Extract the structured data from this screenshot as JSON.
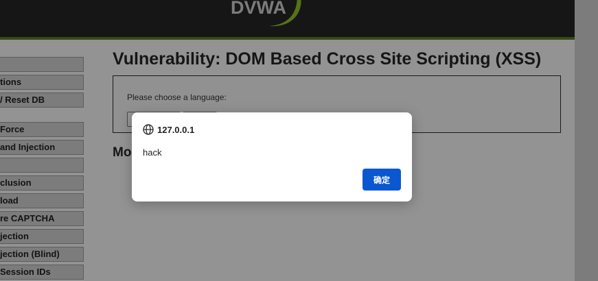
{
  "header": {
    "logo_text": "DVWA"
  },
  "menu": {
    "items": [
      {
        "label": ""
      },
      {
        "label": "tions"
      },
      {
        "label": "/ Reset DB"
      },
      {
        "label": ""
      },
      {
        "label": "Force"
      },
      {
        "label": "and Injection"
      },
      {
        "label": ""
      },
      {
        "label": "clusion"
      },
      {
        "label": "load"
      },
      {
        "label": "re CAPTCHA"
      },
      {
        "label": "jection"
      },
      {
        "label": "jection (Blind)"
      },
      {
        "label": "Session IDs"
      }
    ]
  },
  "main": {
    "title": "Vulnerability: DOM Based Cross Site Scripting (XSS)",
    "choose_label": "Please choose a language:",
    "more_info_heading": "Mo"
  },
  "dialog": {
    "origin": "127.0.0.1",
    "message": "hack",
    "ok_label": "确定",
    "icon": "globe-icon"
  },
  "colors": {
    "header_bg": "#262626",
    "header_accent": "#5e7d1f",
    "logo_swoosh": "#8fbf2a",
    "button_primary": "#0b57d0"
  }
}
